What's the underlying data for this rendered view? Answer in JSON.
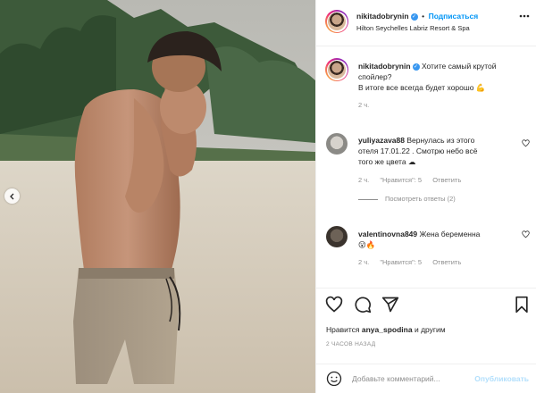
{
  "post": {
    "author": "nikitadobrynin",
    "follow_label": "Подписаться",
    "location": "Hilton Seychelles Labriz Resort & Spa",
    "verified_icon": "verified-badge-icon"
  },
  "caption": {
    "author": "nikitadobrynin",
    "line1": "Хотите самый крутой",
    "line2": "спойлер?",
    "line3": "В итоге все всегда будет хорошо",
    "emoji": "💪",
    "time": "2 ч."
  },
  "comments": [
    {
      "author": "yuliyazava88",
      "line1": "Вернулась из этого",
      "line2": "отеля 17.01.22 . Смотрю небо всё",
      "line3": "того же цвета",
      "emoji": "☁",
      "time": "2 ч.",
      "likes": "\"Нравится\": 5",
      "reply": "Ответить",
      "view_replies": "Посмотреть ответы (2)"
    },
    {
      "author": "valentinovna849",
      "line1": "Жена беременна",
      "emoji": "😮🔥",
      "time": "2 ч.",
      "likes": "\"Нравится\": 5",
      "reply": "Ответить"
    }
  ],
  "likes_prefix": "Нравится",
  "likes_user": "anya_spodina",
  "likes_suffix": "и другим",
  "time_ago": "2 ЧАСОВ НАЗАД",
  "add_comment": {
    "placeholder": "Добавьте комментарий...",
    "publish_label": "Опубликовать"
  },
  "colors": {
    "link": "#0095f6",
    "verified": "#3897f0",
    "muted": "#8e8e8e",
    "publish_disabled": "#b2dffc"
  },
  "icons": [
    "heart-icon",
    "comment-icon",
    "share-icon",
    "bookmark-icon",
    "emoji-icon",
    "chevron-left-icon"
  ]
}
